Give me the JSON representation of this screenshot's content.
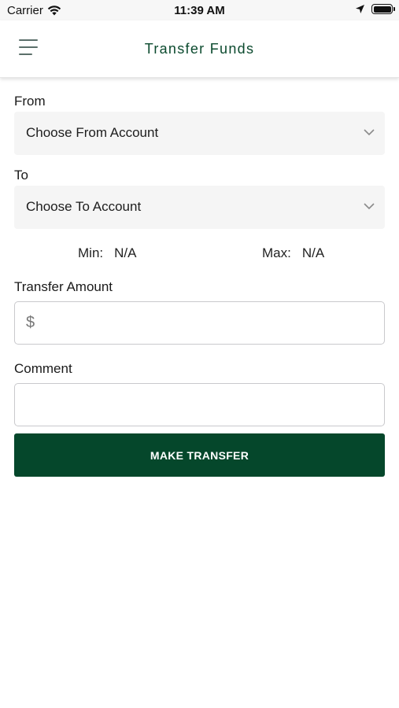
{
  "status_bar": {
    "carrier": "Carrier",
    "time": "11:39 AM",
    "icons": [
      "wifi-icon",
      "location-arrow-icon",
      "battery-icon"
    ]
  },
  "header": {
    "title": "Transfer Funds",
    "menu_icon": "hamburger-menu-icon",
    "title_color": "#0b4a2e"
  },
  "form": {
    "from": {
      "label": "From",
      "selected": "Choose From Account",
      "icon": "chevron-down-icon"
    },
    "to": {
      "label": "To",
      "selected": "Choose To Account",
      "icon": "chevron-down-icon"
    },
    "limits": {
      "min_label": "Min:",
      "min_value": "N/A",
      "max_label": "Max:",
      "max_value": "N/A"
    },
    "amount": {
      "label": "Transfer Amount",
      "prefix": "$",
      "value": "",
      "placeholder": ""
    },
    "comment": {
      "label": "Comment",
      "value": "",
      "placeholder": ""
    },
    "submit_label": "MAKE TRANSFER",
    "submit_color": "#05472b"
  }
}
